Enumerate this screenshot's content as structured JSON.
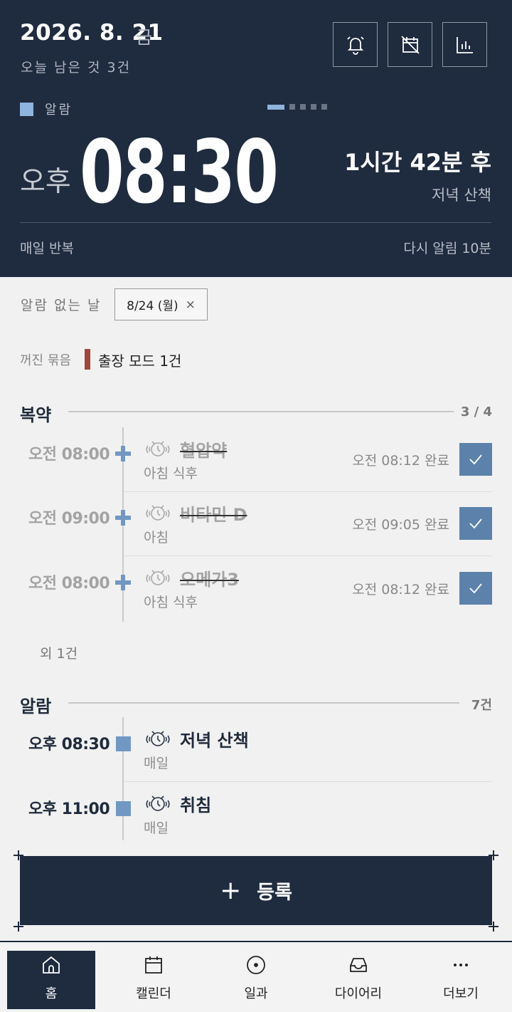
{
  "header": {
    "date": "2026. 8. 21",
    "weekday": "금",
    "remaining": "오늘 남은 것 3건",
    "section_label": "알람",
    "buttons": [
      {
        "name": "alarm-bell-button",
        "icon": "bell-icon"
      },
      {
        "name": "calendar-off-button",
        "icon": "calendar-off-icon"
      },
      {
        "name": "stats-button",
        "icon": "bar-chart-icon"
      }
    ],
    "pager": {
      "count": 5,
      "active": 0
    },
    "next_alarm": {
      "ampm": "오후",
      "time": "08:30",
      "countdown": "1시간 42분 후",
      "label": "저녁 산책",
      "repeat": "매일 반복",
      "snooze": "다시 알림 10분"
    }
  },
  "no_alarm_day": {
    "label": "알람 없는 날",
    "chip": "8/24 (월)",
    "chip_close": "×"
  },
  "off_group": {
    "label": "꺼진 묶음",
    "value": "출장 모드 1건"
  },
  "medicine": {
    "title": "복약",
    "count": "3 / 4",
    "items": [
      {
        "time": "오전 08:00",
        "name": "혈압약",
        "sub": "아침 식후",
        "status": "오전 08:12 완료",
        "done": true
      },
      {
        "time": "오전 09:00",
        "name": "비타민 D",
        "sub": "아침",
        "status": "오전 09:05 완료",
        "done": true
      },
      {
        "time": "오전 08:00",
        "name": "오메가3",
        "sub": "아침 식후",
        "status": "오전 08:12 완료",
        "done": true
      }
    ],
    "more": "외 1건"
  },
  "alarms": {
    "title": "알람",
    "count": "7건",
    "items": [
      {
        "time": "오후 08:30",
        "name": "저녁 산책",
        "sub": "매일"
      },
      {
        "time": "오후 11:00",
        "name": "취침",
        "sub": "매일"
      }
    ]
  },
  "register": {
    "plus": "+",
    "label": "등록"
  },
  "nav": [
    {
      "label": "홈",
      "icon": "home-icon",
      "active": true
    },
    {
      "label": "캘린더",
      "icon": "calendar-icon",
      "active": false
    },
    {
      "label": "일과",
      "icon": "routine-icon",
      "active": false
    },
    {
      "label": "다이어리",
      "icon": "inbox-icon",
      "active": false
    },
    {
      "label": "더보기",
      "icon": "more-icon",
      "active": false
    }
  ],
  "colors": {
    "navy": "#1f2b3e",
    "accent": "#8fb4dd",
    "check": "#5c82ab",
    "off_bar": "#a2453a"
  }
}
